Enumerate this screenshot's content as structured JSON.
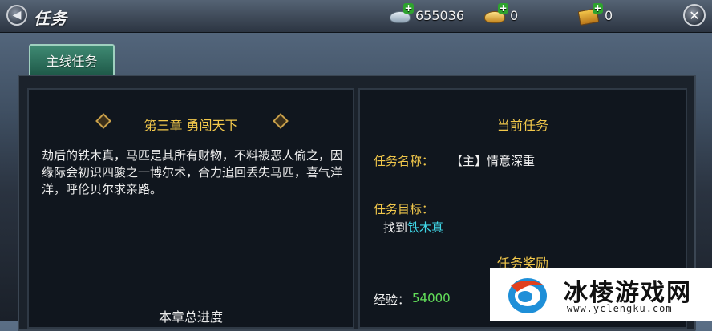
{
  "header": {
    "title": "任务",
    "silver": "655036",
    "gold": "0",
    "ticket": "0"
  },
  "tabs": [
    {
      "label": "主线任务"
    }
  ],
  "left": {
    "chapter": "第三章  勇闯天下",
    "story": "劫后的铁木真，马匹是其所有财物，不料被恶人偷之，因缘际会初识四骏之一博尔术，合力追回丢失马匹，喜气洋洋，呼伦贝尔求亲路。",
    "progress_label": "本章总进度"
  },
  "right": {
    "current_title": "当前任务",
    "name_label": "任务名称：",
    "name_value": "【主】情意深重",
    "goal_label": "任务目标：",
    "goal_prefix": "找到",
    "goal_target": "铁木真",
    "reward_title": "任务奖励",
    "exp_label": "经验：",
    "exp_value": "54000"
  },
  "watermark": {
    "title": "冰棱游戏网",
    "url": "www.yclengku.com"
  },
  "colors": {
    "accent_gold": "#f2c84b",
    "highlight_cyan": "#3fd6e6",
    "value_green": "#63e05a"
  }
}
